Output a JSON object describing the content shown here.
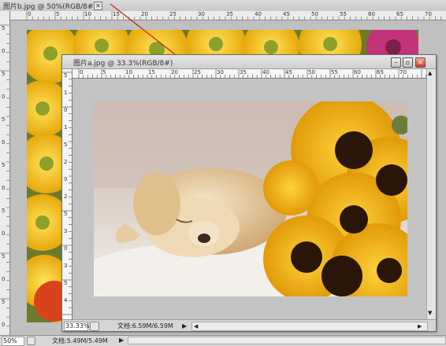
{
  "back_window": {
    "title": "图片b.jpg @ 50%(RGB/8#)",
    "close_glyph": "✕",
    "zoom": "50%",
    "doc_info": "文档:5.49M/5.49M",
    "arrow": "▶",
    "ruler_top_labels": [
      "0",
      "5",
      "10",
      "15",
      "20",
      "25",
      "30",
      "35",
      "40",
      "45",
      "50",
      "55",
      "60",
      "65",
      "70"
    ],
    "ruler_left_labels": [
      "5",
      "0",
      "5",
      "0",
      "5",
      "0",
      "5",
      "0",
      "5",
      "0",
      "5",
      "0",
      "5",
      "0"
    ]
  },
  "front_window": {
    "title": "图片a.jpg @ 33.3%(RGB/8#)",
    "minimize_glyph": "–",
    "restore_glyph": "▫",
    "close_glyph": "✕",
    "zoom": "33.33%",
    "doc_info": "文档:6.59M/6.59M",
    "arrow": "▶",
    "ruler_top_labels": [
      "0",
      "5",
      "10",
      "15",
      "20",
      "25",
      "30",
      "35",
      "40",
      "45",
      "50",
      "55",
      "60",
      "65",
      "70"
    ],
    "ruler_left_labels": [
      "5",
      "1",
      "0",
      "1",
      "5",
      "2",
      "0",
      "2",
      "5",
      "3",
      "0",
      "3",
      "5",
      "4"
    ]
  },
  "annotation": {
    "arrow_color": "#d0201c"
  },
  "colors": {
    "workspace": "#c0c0c0",
    "sunflower": "#f2b817",
    "puppy": "#e9d3ad"
  }
}
